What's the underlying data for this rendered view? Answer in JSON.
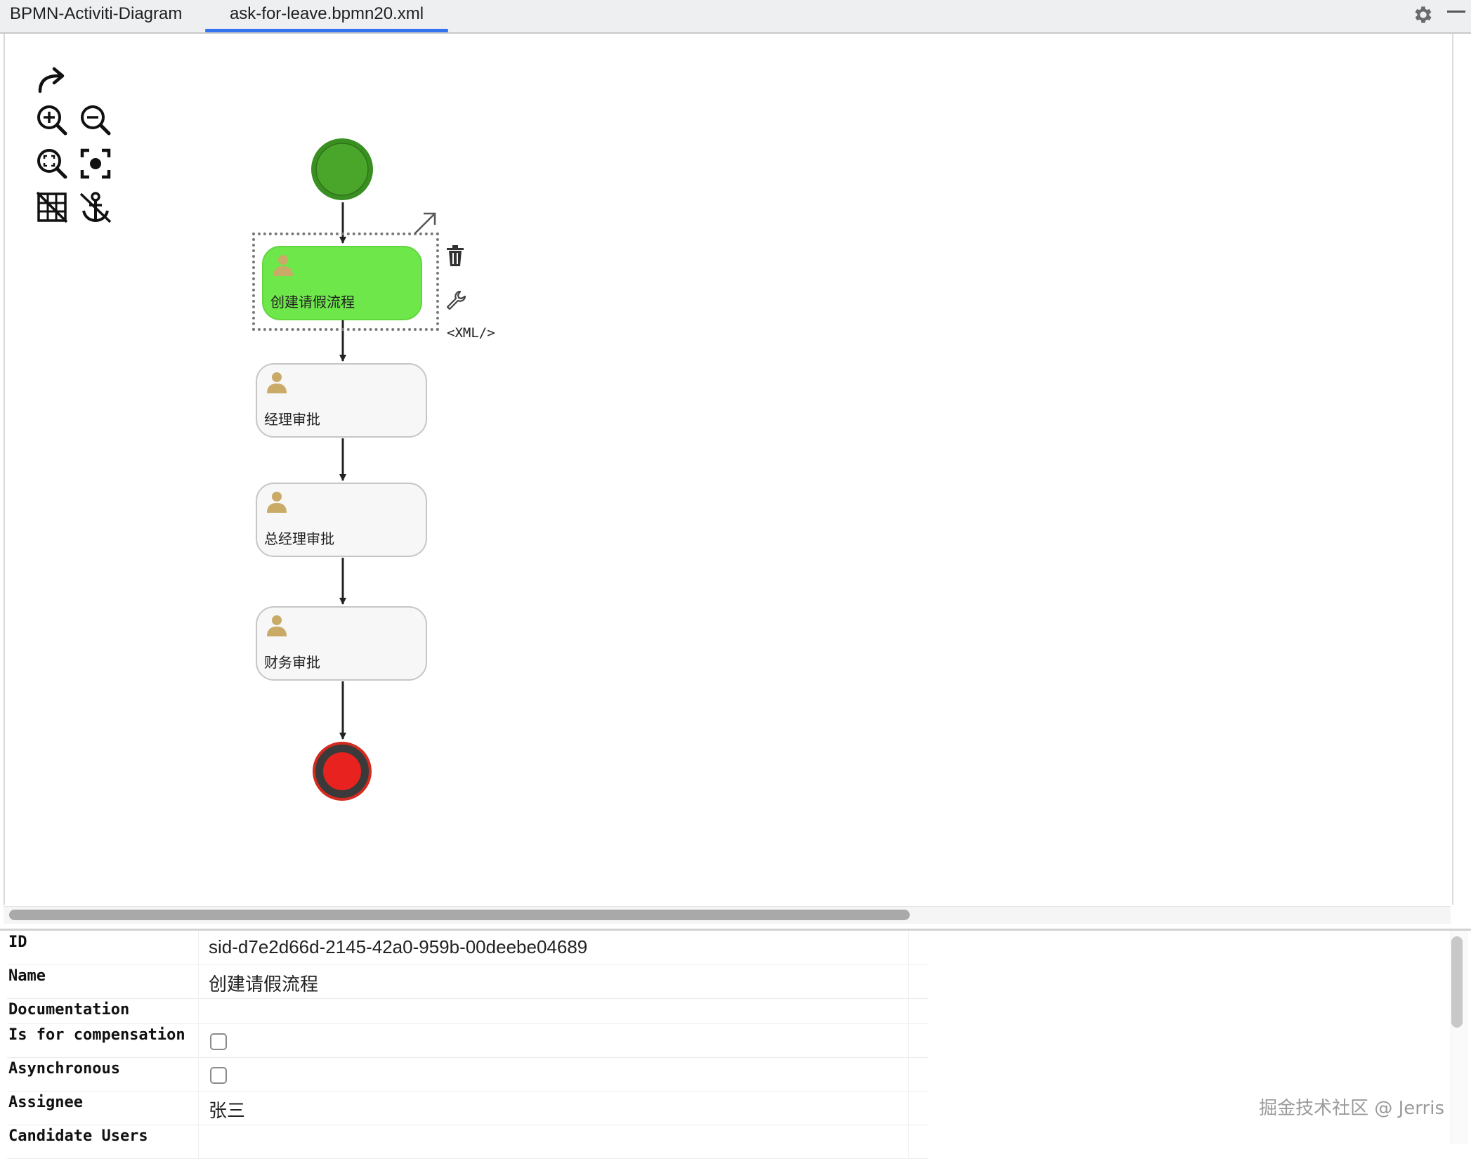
{
  "tabs": [
    {
      "label": "BPMN-Activiti-Diagram"
    },
    {
      "label": "ask-for-leave.bpmn20.xml",
      "active": true
    }
  ],
  "toolbar": {
    "icons": [
      "redo-icon",
      "zoom-in-icon",
      "zoom-out-icon",
      "zoom-actual-icon",
      "zoom-fit-icon",
      "grid-toggle-icon",
      "anchor-icon"
    ]
  },
  "diagram": {
    "tasks": [
      {
        "label": "创建请假流程",
        "selected": true
      },
      {
        "label": "经理审批"
      },
      {
        "label": "总经理审批"
      },
      {
        "label": "财务审批"
      }
    ],
    "xml_label": "<XML/>",
    "colors": {
      "start": "#4aa62a",
      "end": "#e8221f",
      "selected_task": "#6ee74b"
    }
  },
  "properties": {
    "rows": [
      {
        "key": "ID",
        "value": "sid-d7e2d66d-2145-42a0-959b-00deebe04689"
      },
      {
        "key": "Name",
        "value": "创建请假流程"
      },
      {
        "key": "Documentation",
        "value": ""
      },
      {
        "key": "Is for compensation",
        "checkbox": true
      },
      {
        "key": "Asynchronous",
        "checkbox": true
      },
      {
        "key": "Assignee",
        "value": "张三"
      },
      {
        "key": "Candidate Users",
        "value": ""
      }
    ]
  },
  "watermark": "掘金技术社区 @ Jerris"
}
